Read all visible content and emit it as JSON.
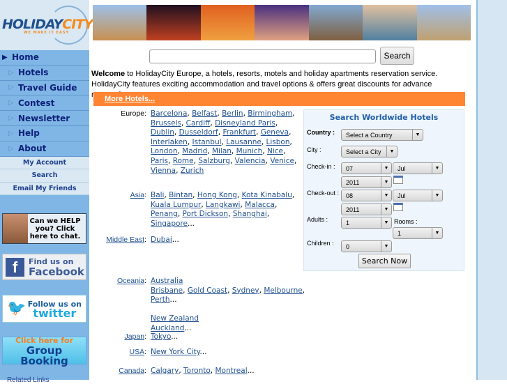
{
  "logo": {
    "name": "HOLIDAY",
    "name2": "CITY",
    "tagline": "WE MAKE IT EASY"
  },
  "nav": [
    {
      "label": "Home",
      "icon": "play-solid-icon"
    },
    {
      "label": "Hotels"
    },
    {
      "label": "Travel Guide"
    },
    {
      "label": "Contest"
    },
    {
      "label": "Newsletter"
    },
    {
      "label": "Help"
    },
    {
      "label": "About"
    }
  ],
  "subnav": [
    "My Account",
    "Search",
    "Email My Friends"
  ],
  "banners": {
    "chat": "Can we HELP you? Click here to chat.",
    "facebook1": "Find us on",
    "facebook2": "Facebook",
    "twitter1": "Follow us on",
    "twitter2": "twitter",
    "group1": "Click here for",
    "group2": "Group Booking",
    "related": "Related Links"
  },
  "search": {
    "placeholder": "",
    "button": "Search"
  },
  "welcome": {
    "bold": "Welcome",
    "text": " to HolidayCity Europe, a hotels, resorts, motels and holiday apartments reservation service. HolidayCity features exciting accommodation and travel options & offers great discounts for advance reservation."
  },
  "more_hotels": "More Hotels...",
  "regions": [
    {
      "label": "Europe:",
      "cities": [
        "Barcelona",
        "Belfast",
        "Berlin",
        "Birmingham",
        "Brussels",
        "Cardiff",
        "Disneyland Paris",
        "Dublin",
        "Dusseldorf",
        "Frankfurt",
        "Geneva",
        "Interlaken",
        "Istanbul",
        "Lausanne",
        "Lisbon",
        "London",
        "Madrid",
        "Milan",
        "Munich",
        "Nice",
        "Paris",
        "Rome",
        "Salzburg",
        "Valencia",
        "Venice",
        "Vienna",
        "Zurich"
      ]
    },
    {
      "label": "Asia",
      "cities": [
        "Bali",
        "Bintan",
        "Hong Kong",
        "Kota Kinabalu",
        "Kuala Lumpur",
        "Langkawi",
        "Malacca",
        "Penang",
        "Port Dickson",
        "Shanghai",
        "Singapore"
      ]
    },
    {
      "label": "Middle East",
      "cities": [
        "Dubai"
      ]
    },
    {
      "label": "Oceania",
      "sub1": "Australia",
      "cities": [
        "Brisbane",
        "Gold Coast",
        "Sydney",
        "Melbourne",
        "Perth"
      ],
      "sub2": "New Zealand",
      "cities2": [
        "Auckland"
      ]
    },
    {
      "label": "Japan",
      "cities": [
        "Tokyo"
      ]
    },
    {
      "label": "USA",
      "cities": [
        "New York City"
      ]
    },
    {
      "label": "Canada",
      "cities": [
        "Calgary",
        "Toronto",
        "Montreal"
      ]
    }
  ],
  "form": {
    "title": "Search Worldwide Hotels",
    "country_label": "Country :",
    "country": "Select a Country",
    "city_label": "City :",
    "city": "Select a City",
    "checkin_label": "Check-in :",
    "checkin_day": "07",
    "checkin_month": "Jul",
    "checkin_year": "2011",
    "checkout_label": "Check-out :",
    "checkout_day": "08",
    "checkout_month": "Jul",
    "checkout_year": "2011",
    "adults_label": "Adults :",
    "adults": "1",
    "rooms_label": "Rooms :",
    "rooms": "1",
    "children_label": "Children :",
    "children": "0",
    "submit": "Search Now"
  },
  "colors": {
    "nav": "#7fb6e6",
    "orange": "#ff8533",
    "link": "#1f4f8f"
  }
}
